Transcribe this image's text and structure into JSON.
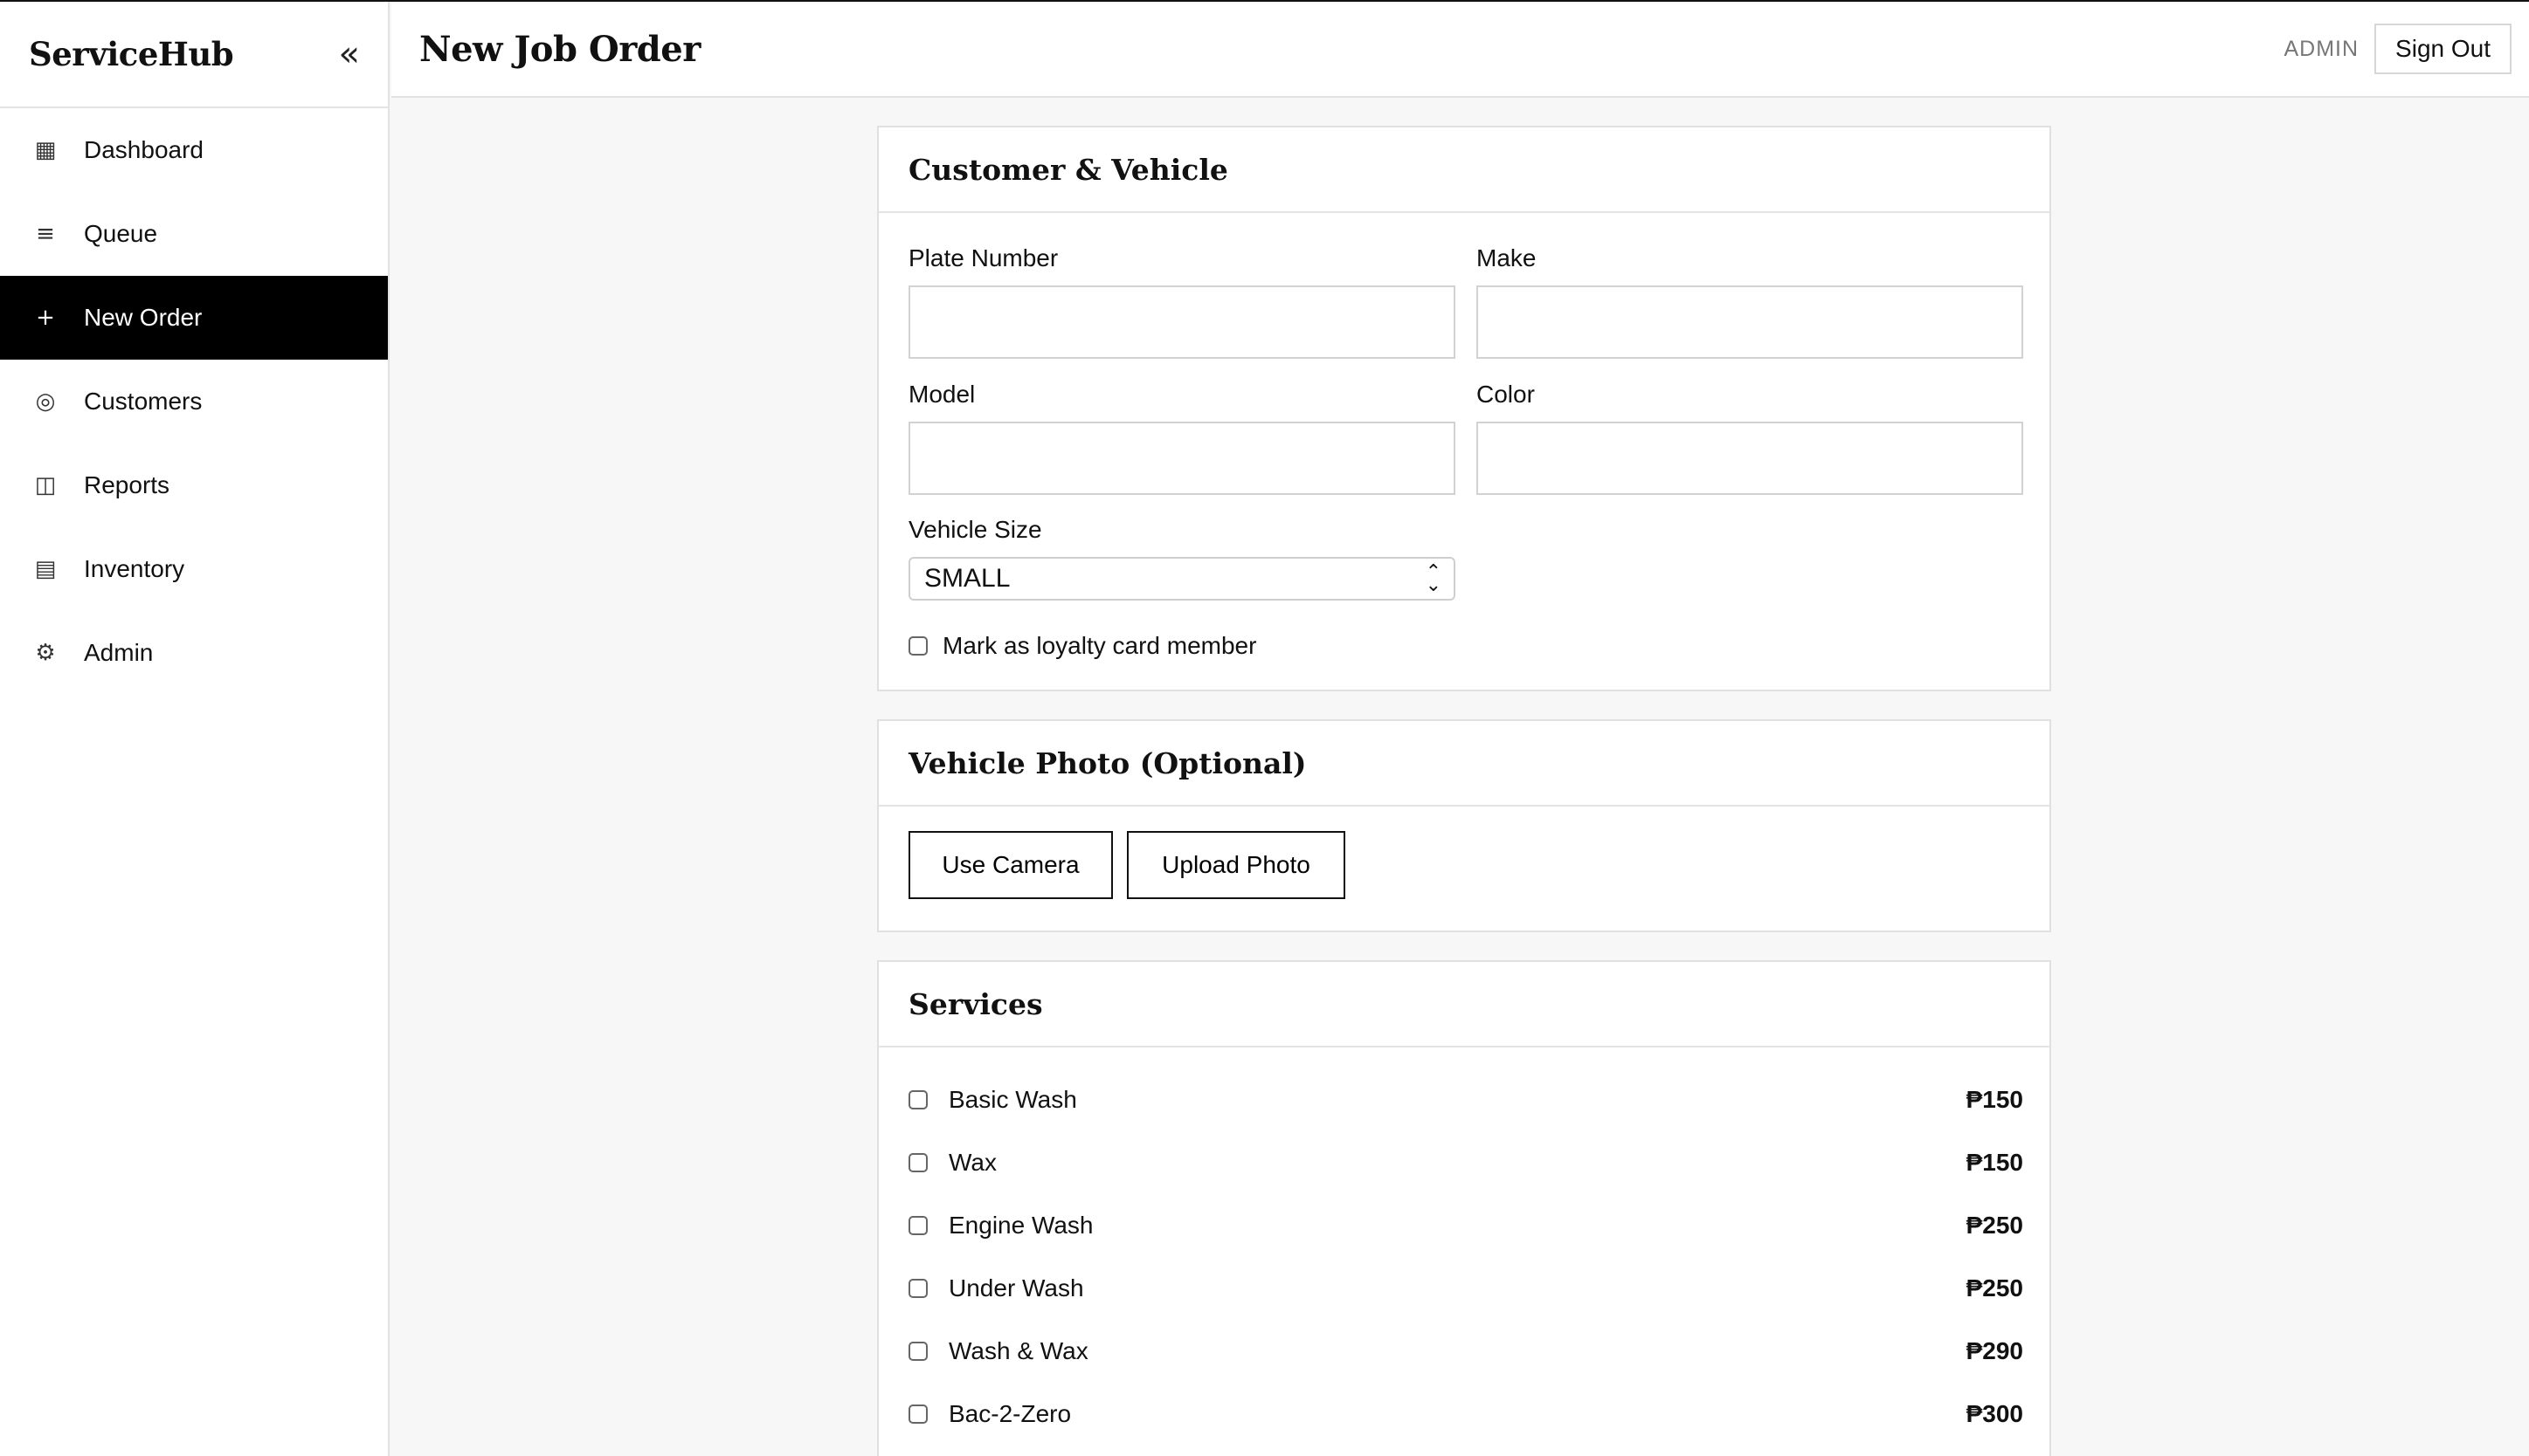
{
  "sidebar": {
    "brand": "ServiceHub",
    "collapse_icon": "«",
    "items": [
      {
        "label": "Dashboard",
        "icon": "▦",
        "icon_name": "dashboard-icon",
        "active": false
      },
      {
        "label": "Queue",
        "icon": "≡",
        "icon_name": "queue-icon",
        "active": false
      },
      {
        "label": "New Order",
        "icon": "+",
        "icon_name": "plus-icon",
        "active": true
      },
      {
        "label": "Customers",
        "icon": "◎",
        "icon_name": "customers-icon",
        "active": false
      },
      {
        "label": "Reports",
        "icon": "◫",
        "icon_name": "reports-icon",
        "active": false
      },
      {
        "label": "Inventory",
        "icon": "▤",
        "icon_name": "inventory-icon",
        "active": false
      },
      {
        "label": "Admin",
        "icon": "⚙",
        "icon_name": "gear-icon",
        "active": false
      }
    ]
  },
  "header": {
    "title": "New Job Order",
    "role": "ADMIN",
    "sign_out": "Sign Out"
  },
  "customer_vehicle": {
    "title": "Customer & Vehicle",
    "plate_label": "Plate Number",
    "plate_value": "",
    "make_label": "Make",
    "make_value": "",
    "model_label": "Model",
    "model_value": "",
    "color_label": "Color",
    "color_value": "",
    "size_label": "Vehicle Size",
    "size_value": "SMALL",
    "loyalty_label": "Mark as loyalty card member",
    "loyalty_checked": false
  },
  "photo": {
    "title": "Vehicle Photo (Optional)",
    "camera_label": "Use Camera",
    "upload_label": "Upload Photo"
  },
  "services": {
    "title": "Services",
    "items": [
      {
        "name": "Basic Wash",
        "price": "₱150",
        "checked": false
      },
      {
        "name": "Wax",
        "price": "₱150",
        "checked": false
      },
      {
        "name": "Engine Wash",
        "price": "₱250",
        "checked": false
      },
      {
        "name": "Under Wash",
        "price": "₱250",
        "checked": false
      },
      {
        "name": "Wash & Wax",
        "price": "₱290",
        "checked": false
      },
      {
        "name": "Bac-2-Zero",
        "price": "₱300",
        "checked": false
      }
    ]
  },
  "colors": {
    "active_nav_bg": "#000000",
    "page_bg": "#f7f7f7",
    "border": "#e0e0e0"
  }
}
